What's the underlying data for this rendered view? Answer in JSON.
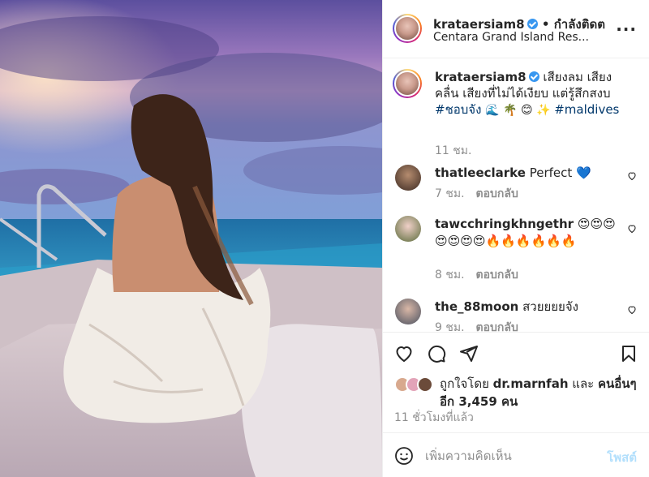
{
  "post": {
    "username": "krataersiam8",
    "follow_text": "กำลังติดต",
    "separator": "•",
    "location": "Centara Grand Island Res..."
  },
  "caption": {
    "username": "krataersiam8",
    "text": "เสียงลม เสียงคลื่น เสียงที่ไม่ได้เงียบ แต่รู้สึกสงบ",
    "hashtag1": "#ชอบจัง",
    "emojis": "🌊 🌴 😊 ✨",
    "hashtag2": "#maldives",
    "time": "11 ชม."
  },
  "comments": [
    {
      "username": "thatleeclarke",
      "text": "Perfect 💙",
      "time": "7 ชม.",
      "reply": "ตอบกลับ"
    },
    {
      "username": "tawcchringkhngethr",
      "text": "😍😍😍😍😍😍😍🔥🔥🔥🔥🔥🔥",
      "time": "8 ชม.",
      "reply": "ตอบกลับ"
    },
    {
      "username": "the_88moon",
      "text": "สวยยยยจัง",
      "time": "9 ชม.",
      "reply": "ตอบกลับ"
    }
  ],
  "likes": {
    "prefix": "ถูกใจโดย",
    "first_user": "dr.marnfah",
    "joiner": "และ",
    "others": "คนอื่นๆ อีก 3,459 คน"
  },
  "post_time": "11 ชั่วโมงที่แล้ว",
  "add_comment": {
    "placeholder": "เพิ่มความคิดเห็น",
    "post_label": "โพสต์"
  },
  "colors": {
    "link": "#00376b",
    "verified": "#3897f0",
    "post_button": "#b2dffc",
    "muted": "#8e8e8e"
  },
  "icons": [
    "more-icon",
    "heart-icon",
    "comment-icon",
    "share-icon",
    "bookmark-icon",
    "smile-icon",
    "verified-icon"
  ]
}
